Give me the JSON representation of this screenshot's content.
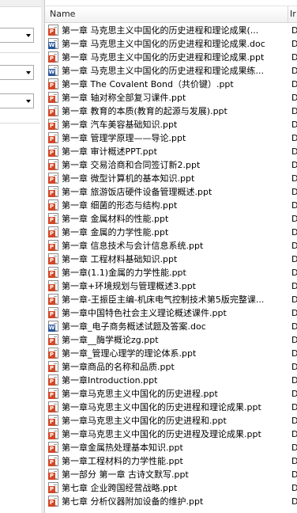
{
  "columns": {
    "name": "Name",
    "other": "Ir"
  },
  "rows": [
    {
      "name": "第一章 马克思主义中国化的历史进程和理论成果(...",
      "type": "ppt",
      "col2": "D"
    },
    {
      "name": "第一章 马克思主义中国化的历史进程和理论成果.doc",
      "type": "doc",
      "col2": "D"
    },
    {
      "name": "第一章 马克思主义中国化的历史进程和理论成果.ppt",
      "type": "ppt",
      "col2": "D"
    },
    {
      "name": "第一章 马克思主义中国化的历史进程和理论成果练...",
      "type": "doc",
      "col2": "D"
    },
    {
      "name": "第一章 The Covalent Bond（共价键）.ppt",
      "type": "ppt",
      "col2": "D"
    },
    {
      "name": "第一章 轴对称全部复习课件.ppt",
      "type": "ppt",
      "col2": "D"
    },
    {
      "name": "第一章 教育的本质(教育的起源与发展).ppt",
      "type": "ppt",
      "col2": "D"
    },
    {
      "name": "第一章 汽车美容基础知识.ppt",
      "type": "ppt",
      "col2": "D"
    },
    {
      "name": "第一章 管理学原理——导论.ppt",
      "type": "ppt",
      "col2": "D"
    },
    {
      "name": "第一章 审计概述PPT.ppt",
      "type": "ppt",
      "col2": "D"
    },
    {
      "name": "第一章 交易洽商和合同签订新2.ppt",
      "type": "ppt",
      "col2": "D"
    },
    {
      "name": "第一章 微型计算机的基本知识.ppt",
      "type": "ppt",
      "col2": "D"
    },
    {
      "name": "第一章 旅游饭店硬件设备管理概述.ppt",
      "type": "ppt",
      "col2": "D"
    },
    {
      "name": "第一章 细菌的形态与结构.ppt",
      "type": "ppt",
      "col2": "D"
    },
    {
      "name": "第一章 金属材料的性能.ppt",
      "type": "ppt",
      "col2": "D"
    },
    {
      "name": "第一章 金属的力学性能.ppt",
      "type": "ppt",
      "col2": "D"
    },
    {
      "name": "第一章 信息技术与会计信息系统.ppt",
      "type": "ppt",
      "col2": "D"
    },
    {
      "name": "第一章 工程材料基础知识.ppt",
      "type": "ppt",
      "col2": "D"
    },
    {
      "name": "第一章(1.1)金属的力学性能.ppt",
      "type": "ppt",
      "col2": "D"
    },
    {
      "name": "第一章+环境规划与管理概述3.ppt",
      "type": "ppt",
      "col2": "D"
    },
    {
      "name": "第一章-王振臣主编-机床电气控制技术第5版完整课...",
      "type": "ppt",
      "col2": "D"
    },
    {
      "name": "第一章中国特色社会主义理论概述课件.ppt",
      "type": "ppt",
      "col2": "D"
    },
    {
      "name": "第一章_电子商务概述试题及答案.doc",
      "type": "doc",
      "col2": "D"
    },
    {
      "name": "第一章__酶学概论zg.ppt",
      "type": "ppt",
      "col2": "D"
    },
    {
      "name": "第一章_管理心理学的理论体系.ppt",
      "type": "ppt",
      "col2": "D"
    },
    {
      "name": "第一章商品的名称和品质.ppt",
      "type": "ppt",
      "col2": "D"
    },
    {
      "name": "第一章Introduction.ppt",
      "type": "ppt",
      "col2": "D"
    },
    {
      "name": "第一章马克思主义中国化的历史进程.ppt",
      "type": "ppt",
      "col2": "D"
    },
    {
      "name": "第一章马克思主义中国化的历史进程和理论成果.ppt",
      "type": "ppt",
      "col2": "D"
    },
    {
      "name": "第一章马克思主义中国化的历史进程和.ppt",
      "type": "ppt",
      "col2": "D"
    },
    {
      "name": "第一章马克思主义中国化的历史进程及理论成果.ppt",
      "type": "ppt",
      "col2": "D"
    },
    {
      "name": "第一章金属热处理基本知识.ppt",
      "type": "ppt",
      "col2": "D"
    },
    {
      "name": "第一章工程材料的力学性能.ppt",
      "type": "ppt",
      "col2": "D"
    },
    {
      "name": "第一部分 第一章 古诗文默写.ppt",
      "type": "ppt",
      "col2": "D"
    },
    {
      "name": "第七章 企业跨国经营战略.ppt",
      "type": "ppt",
      "col2": "D"
    },
    {
      "name": "第七章 分析仪器附加设备的维护.ppt",
      "type": "ppt",
      "col2": "D"
    }
  ]
}
